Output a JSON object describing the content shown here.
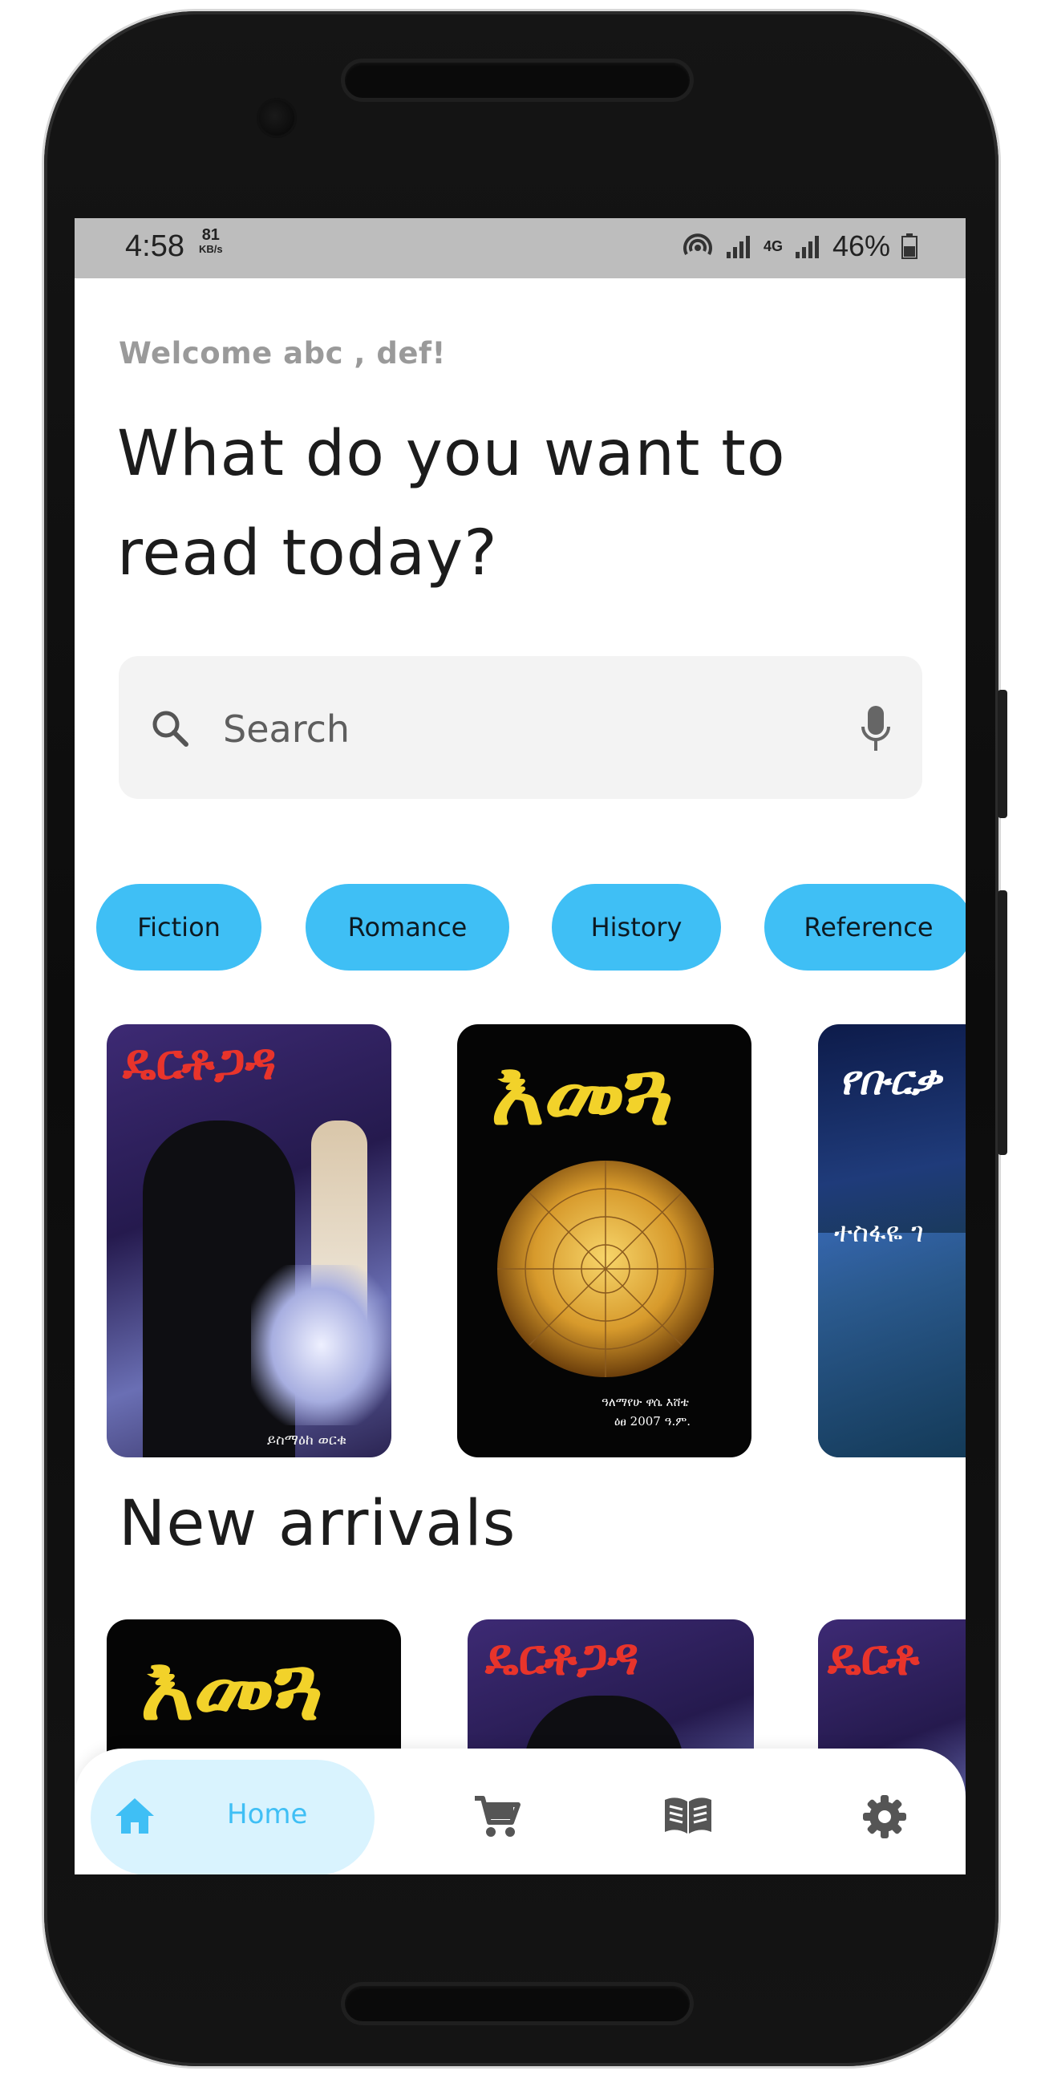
{
  "status_bar": {
    "time": "4:58",
    "speed_value": "81",
    "speed_unit": "KB/s",
    "network": "4G",
    "battery": "46%"
  },
  "welcome": "Welcome abc , def!",
  "headline": "What do you want to read today?",
  "search": {
    "placeholder": "Search",
    "icon": "search-icon",
    "mic_icon": "microphone-icon"
  },
  "categories": [
    "Fiction",
    "Romance",
    "History",
    "Reference"
  ],
  "featured_books": [
    {
      "title": "ዴርቶጋዳ",
      "author": "ይስማዕከ ወርቁ"
    },
    {
      "title": "እመጓ",
      "author": "ዓለማየሁ ዋሴ እሸቴ",
      "edition": "ዕፀ 2007 ዓ.ም."
    },
    {
      "title": "የቡርቃ",
      "author": "ተስፋዬ ገ"
    }
  ],
  "new_arrivals": {
    "title": "New arrivals",
    "books": [
      {
        "title": "እመጓ"
      },
      {
        "title": "ዴርቶጋዳ"
      },
      {
        "title": "ዴርቶ"
      }
    ]
  },
  "bottom_nav": {
    "home_label": "Home",
    "items": [
      "home-icon",
      "cart-icon",
      "book-icon",
      "settings-icon"
    ]
  },
  "colors": {
    "accent": "#3fbff5",
    "accent_light": "#d9f3fe",
    "status_bar": "#bdbdbd",
    "cover_red": "#e8342b",
    "cover_yellow": "#f2d22a"
  }
}
